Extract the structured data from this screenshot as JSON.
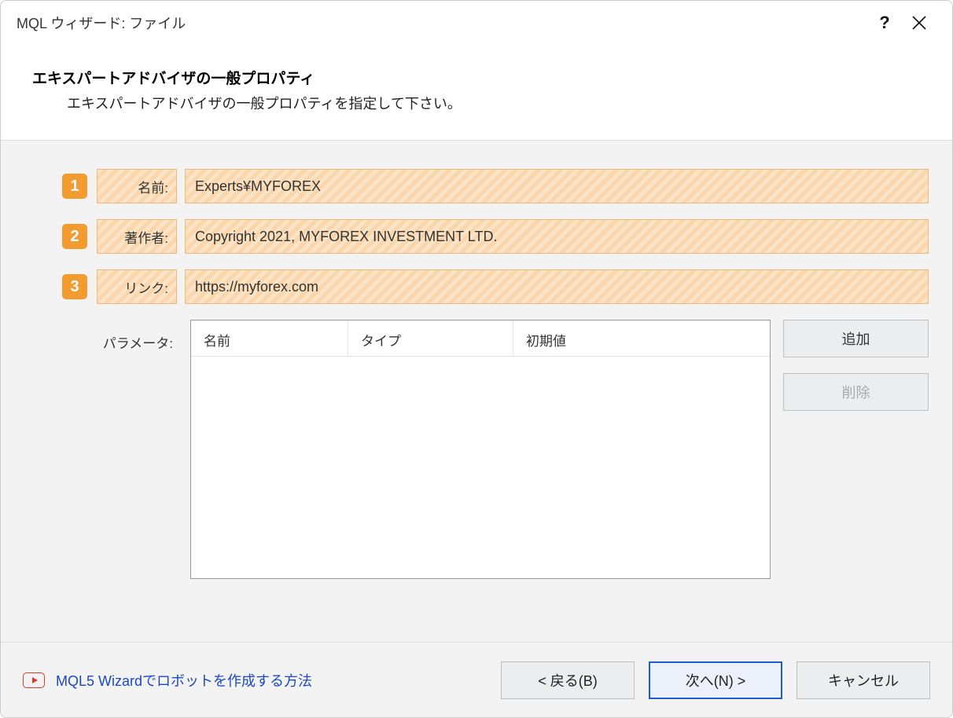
{
  "titlebar": {
    "title": "MQL ウィザード: ファイル"
  },
  "header": {
    "heading": "エキスパートアドバイザの一般プロパティ",
    "subtitle": "エキスパートアドバイザの一般プロパティを指定して下さい。"
  },
  "fields": {
    "name": {
      "badge": "1",
      "label": "名前:",
      "value": "Experts¥MYFOREX"
    },
    "author": {
      "badge": "2",
      "label": "著作者:",
      "value": "Copyright 2021, MYFOREX INVESTMENT LTD."
    },
    "link": {
      "badge": "3",
      "label": "リンク:",
      "value": "https://myforex.com"
    }
  },
  "params": {
    "label": "パラメータ:",
    "columns": {
      "name": "名前",
      "type": "タイプ",
      "initial": "初期値"
    },
    "buttons": {
      "add": "追加",
      "delete": "削除"
    }
  },
  "footer": {
    "link": "MQL5 Wizardでロボットを作成する方法",
    "back": "< 戻る(B)",
    "next": "次へ(N) >",
    "cancel": "キャンセル"
  }
}
